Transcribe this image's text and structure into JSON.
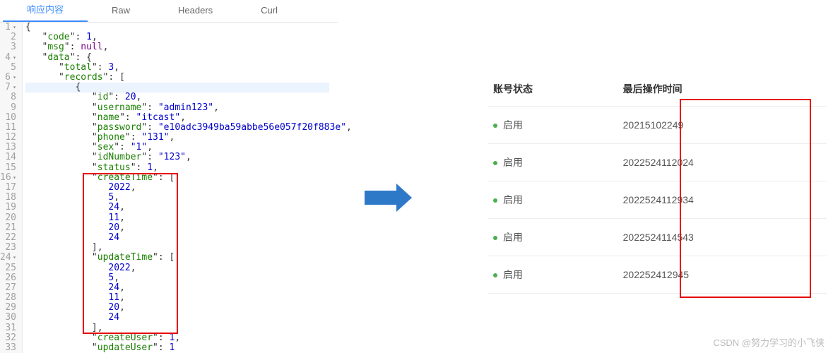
{
  "tabs": {
    "response": "响应内容",
    "raw": "Raw",
    "headers": "Headers",
    "curl": "Curl"
  },
  "code": {
    "l1": "{",
    "l2_k": "code",
    "l2_v": "1",
    "l3_k": "msg",
    "l3_v": "null",
    "l4_k": "data",
    "l5_k": "total",
    "l5_v": "3",
    "l6_k": "records",
    "l8_k": "id",
    "l8_v": "20",
    "l9_k": "username",
    "l9_v": "\"admin123\"",
    "l10_k": "name",
    "l10_v": "\"itcast\"",
    "l11_k": "password",
    "l11_v": "\"e10adc3949ba59abbe56e057f20f883e\"",
    "l12_k": "phone",
    "l12_v": "\"131\"",
    "l13_k": "sex",
    "l13_v": "\"1\"",
    "l14_k": "idNumber",
    "l14_v": "\"123\"",
    "l15_k": "status",
    "l15_v": "1",
    "l16_k": "createTime",
    "l17": "2022",
    "l18": "5",
    "l19": "24",
    "l20": "11",
    "l21": "20",
    "l22": "24",
    "l24_k": "updateTime",
    "l25": "2022",
    "l26": "5",
    "l27": "24",
    "l28": "11",
    "l29": "20",
    "l30": "24",
    "l32_k": "createUser",
    "l32_v": "1",
    "l33_k": "updateUser",
    "l33_v": "1"
  },
  "table": {
    "headers": {
      "status": "账号状态",
      "lastOp": "最后操作时间"
    },
    "rows": [
      {
        "status": "启用",
        "lastOp": "20215102249"
      },
      {
        "status": "启用",
        "lastOp": "2022524112024"
      },
      {
        "status": "启用",
        "lastOp": "2022524112934"
      },
      {
        "status": "启用",
        "lastOp": "2022524114543"
      },
      {
        "status": "启用",
        "lastOp": "202252412945"
      }
    ]
  },
  "watermark": "CSDN @努力学习的小飞侠"
}
